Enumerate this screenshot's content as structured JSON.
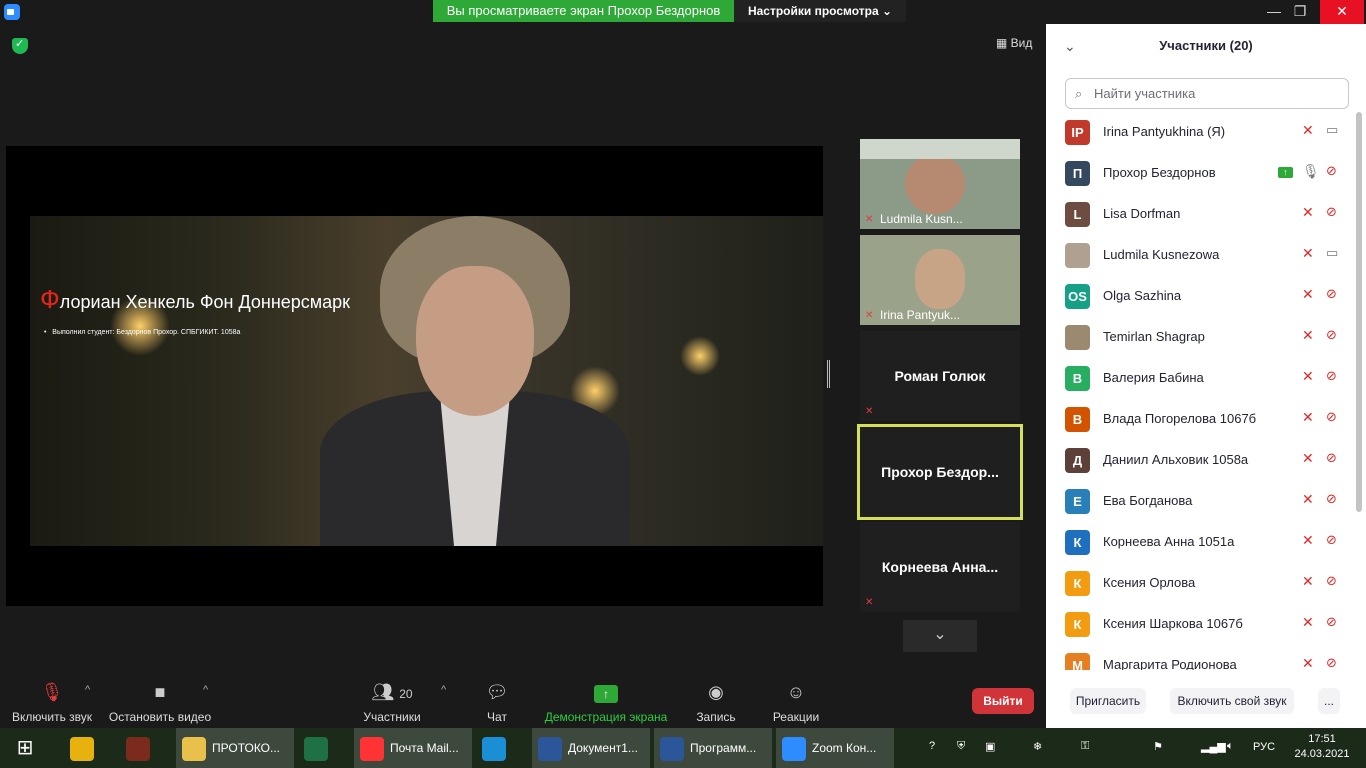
{
  "titlebar": {
    "share_banner": "Вы просматриваете экран Прохор Бездорнов",
    "view_settings": "Настройки просмотра",
    "view_settings_icon": "chevron-down-icon",
    "minimize": "—",
    "maximize": "❐",
    "close": "✕"
  },
  "stage": {
    "view_label": "Вид",
    "slide": {
      "title_first": "Ф",
      "title_rest": "лориан Хенкель Фон Доннерсмарк",
      "subtitle": "Выполнил студент: Бездорнов Прохор. СПБГИКИТ. 1058а"
    },
    "tiles": [
      {
        "name": "Ludmila Kusn...",
        "type": "video"
      },
      {
        "name": "Irina Pantyuk...",
        "type": "video"
      },
      {
        "name": "Роман Голюк",
        "type": "name"
      },
      {
        "name": "Прохор  Бездор...",
        "type": "name"
      },
      {
        "name": "Корнеева  Анна...",
        "type": "name"
      }
    ]
  },
  "toolbar": {
    "unmute": "Включить звук",
    "stop_video": "Остановить видео",
    "participants_count": "20",
    "participants": "Участники",
    "chat": "Чат",
    "share_screen": "Демонстрация экрана",
    "record": "Запись",
    "reactions": "Реакции",
    "leave": "Выйти"
  },
  "panel": {
    "title": "Участники (20)",
    "search_placeholder": "Найти участника",
    "participants": [
      {
        "initials": "IP",
        "name": "Irina Pantyukhina (Я)",
        "color": "#c0392b",
        "mic_muted": true,
        "cam_off": false
      },
      {
        "initials": "П",
        "name": "Прохор Бездорнов",
        "color": "#34495e",
        "mic_muted": false,
        "cam_off": true,
        "sharing": true
      },
      {
        "initials": "L",
        "name": "Lisa Dorfman",
        "color": "#6d4c41",
        "mic_muted": true,
        "cam_off": true
      },
      {
        "initials": "",
        "name": "Ludmila Kusnezowa",
        "color": "#b0a090",
        "mic_muted": true,
        "cam_off": false
      },
      {
        "initials": "OS",
        "name": "Olga Sazhina",
        "color": "#16a085",
        "mic_muted": true,
        "cam_off": true
      },
      {
        "initials": "",
        "name": "Temirlan Shagrap",
        "color": "#9c8a70",
        "mic_muted": true,
        "cam_off": true
      },
      {
        "initials": "В",
        "name": "Валерия Бабина",
        "color": "#27ae60",
        "mic_muted": true,
        "cam_off": true
      },
      {
        "initials": "В",
        "name": "Влада Погорелова 1067б",
        "color": "#d35400",
        "mic_muted": true,
        "cam_off": true
      },
      {
        "initials": "Д",
        "name": "Даниил Альховик 1058а",
        "color": "#5d4037",
        "mic_muted": true,
        "cam_off": true
      },
      {
        "initials": "Е",
        "name": "Ева Богданова",
        "color": "#2980b9",
        "mic_muted": true,
        "cam_off": true
      },
      {
        "initials": "К",
        "name": "Корнеева Анна 1051а",
        "color": "#1f6fbf",
        "mic_muted": true,
        "cam_off": true
      },
      {
        "initials": "К",
        "name": "Ксения Орлова",
        "color": "#f39c12",
        "mic_muted": true,
        "cam_off": true
      },
      {
        "initials": "К",
        "name": "Ксения Шаркова 1067б",
        "color": "#f39c12",
        "mic_muted": true,
        "cam_off": true
      },
      {
        "initials": "М",
        "name": "Маргарита Родионова",
        "color": "#e67e22",
        "mic_muted": true,
        "cam_off": true
      }
    ],
    "invite": "Пригласить",
    "unmute_me": "Включить свой звук",
    "more": "..."
  },
  "taskbar": {
    "tasks": [
      {
        "label": "",
        "color": "#e8b20e"
      },
      {
        "label": "",
        "color": "#7a2b1b"
      },
      {
        "label": "ПРОТОКО...",
        "color": "#e8c04a"
      },
      {
        "label": "",
        "color": "#1e7145"
      },
      {
        "label": "Почта Mail...",
        "color": "#ff3333"
      },
      {
        "label": "",
        "color": "#1b8fd6"
      },
      {
        "label": "Документ1...",
        "color": "#2b579a"
      },
      {
        "label": "Программ...",
        "color": "#2b579a"
      },
      {
        "label": "Zoom Кон...",
        "color": "#2d8cff"
      }
    ],
    "lang": "РУС",
    "time": "17:51",
    "date": "24.03.2021"
  }
}
